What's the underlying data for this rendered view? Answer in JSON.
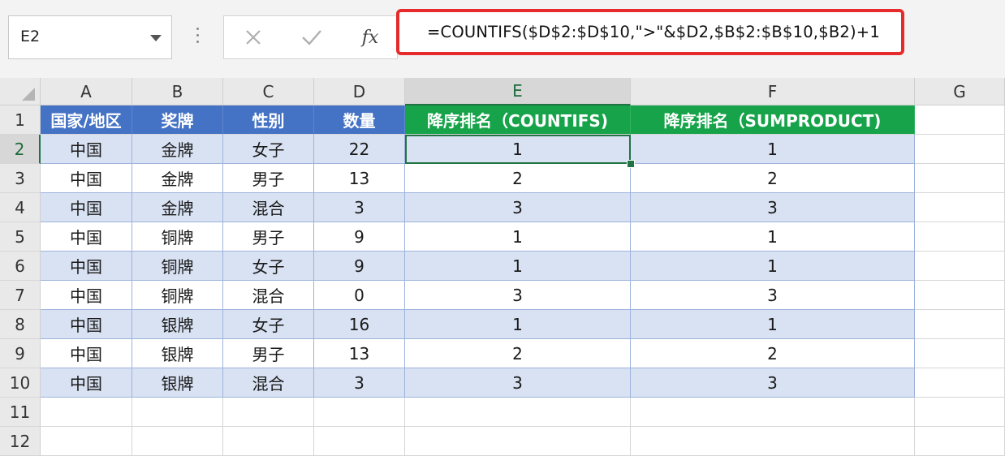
{
  "name_box": {
    "value": "E2"
  },
  "formula_bar": {
    "cancel_icon": "close-icon",
    "enter_icon": "checkmark-icon",
    "fx_label": "fx",
    "formula": "=COUNTIFS($D$2:$D$10,\">\"&$D2,$B$2:$B$10,$B2)+1",
    "highlight_color": "#e52b2b"
  },
  "sheet": {
    "columns": [
      "A",
      "B",
      "C",
      "D",
      "E",
      "F",
      "G"
    ],
    "rows": [
      "1",
      "2",
      "3",
      "4",
      "5",
      "6",
      "7",
      "8",
      "9",
      "10",
      "11",
      "12"
    ],
    "selected_cell": "E2",
    "header": {
      "a": "国家/地区",
      "b": "奖牌",
      "c": "性别",
      "d": "数量",
      "e": "降序排名（COUNTIFS)",
      "f": "降序排名（SUMPRODUCT)"
    },
    "data": [
      {
        "a": "中国",
        "b": "金牌",
        "c": "女子",
        "d": "22",
        "e": "1",
        "f": "1"
      },
      {
        "a": "中国",
        "b": "金牌",
        "c": "男子",
        "d": "13",
        "e": "2",
        "f": "2"
      },
      {
        "a": "中国",
        "b": "金牌",
        "c": "混合",
        "d": "3",
        "e": "3",
        "f": "3"
      },
      {
        "a": "中国",
        "b": "铜牌",
        "c": "男子",
        "d": "9",
        "e": "1",
        "f": "1"
      },
      {
        "a": "中国",
        "b": "铜牌",
        "c": "女子",
        "d": "9",
        "e": "1",
        "f": "1"
      },
      {
        "a": "中国",
        "b": "铜牌",
        "c": "混合",
        "d": "0",
        "e": "3",
        "f": "3"
      },
      {
        "a": "中国",
        "b": "银牌",
        "c": "女子",
        "d": "16",
        "e": "1",
        "f": "1"
      },
      {
        "a": "中国",
        "b": "银牌",
        "c": "男子",
        "d": "13",
        "e": "2",
        "f": "2"
      },
      {
        "a": "中国",
        "b": "银牌",
        "c": "混合",
        "d": "3",
        "e": "3",
        "f": "3"
      }
    ],
    "colors": {
      "header_blue": "#4472c4",
      "header_green": "#16a34a",
      "band": "#d9e2f3",
      "selection": "#217346"
    }
  }
}
